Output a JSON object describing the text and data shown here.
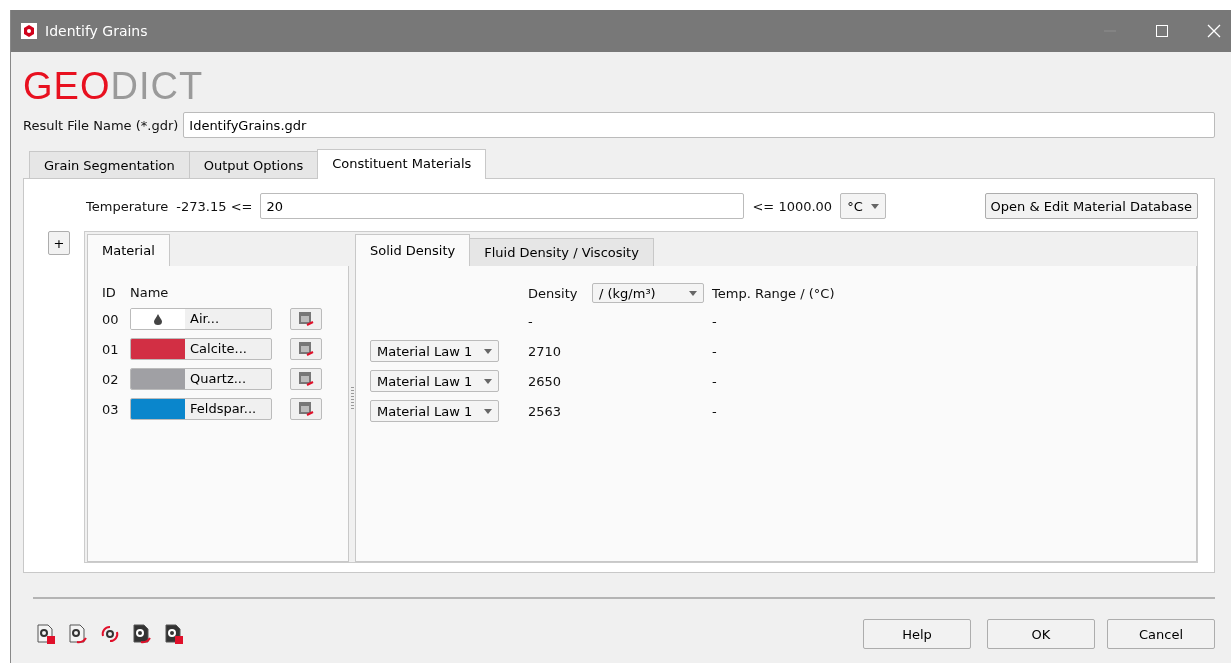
{
  "window": {
    "title": "Identify Grains"
  },
  "logo": {
    "part_1": "GEO",
    "part_2": "DICT"
  },
  "result_file": {
    "label": "Result File Name (*.gdr)",
    "value": "IdentifyGrains.gdr"
  },
  "tabs": [
    {
      "label": "Grain Segmentation",
      "selected": false
    },
    {
      "label": "Output Options",
      "selected": false
    },
    {
      "label": "Constituent Materials",
      "selected": true
    }
  ],
  "temperature": {
    "label": "Temperature",
    "min": "-273.15 <=",
    "value": "20",
    "max": "<= 1000.00",
    "unit": "°C"
  },
  "database_button": "Open & Edit Material Database",
  "add_button": "+",
  "material_tab": {
    "label": "Material",
    "selected": true
  },
  "material_columns": [
    "ID",
    "Name"
  ],
  "materials": [
    {
      "id": "00",
      "name": "Air...",
      "kind": "fluid",
      "color": "#ffffff"
    },
    {
      "id": "01",
      "name": "Calcite...",
      "kind": "solid",
      "color": "#d22f44"
    },
    {
      "id": "02",
      "name": "Quartz...",
      "kind": "solid",
      "color": "#a0a0a4"
    },
    {
      "id": "03",
      "name": "Feldspar...",
      "kind": "solid",
      "color": "#0a86cc"
    }
  ],
  "property_tabs": [
    {
      "label": "Solid Density",
      "selected": true
    },
    {
      "label": "Fluid Density / Viscosity",
      "selected": false
    }
  ],
  "density_header": {
    "label": "Density",
    "unit": "/ (kg/m³)",
    "range": "Temp. Range / (°C)"
  },
  "density_rows": [
    {
      "density": "-",
      "range": "-"
    },
    {
      "law": "Material Law 1",
      "density": "2710",
      "range": "-"
    },
    {
      "law": "Material Law 1",
      "density": "2650",
      "range": "-"
    },
    {
      "law": "Material Law 1",
      "density": "2563",
      "range": "-"
    }
  ],
  "footer_buttons": [
    "Help",
    "OK",
    "Cancel"
  ]
}
